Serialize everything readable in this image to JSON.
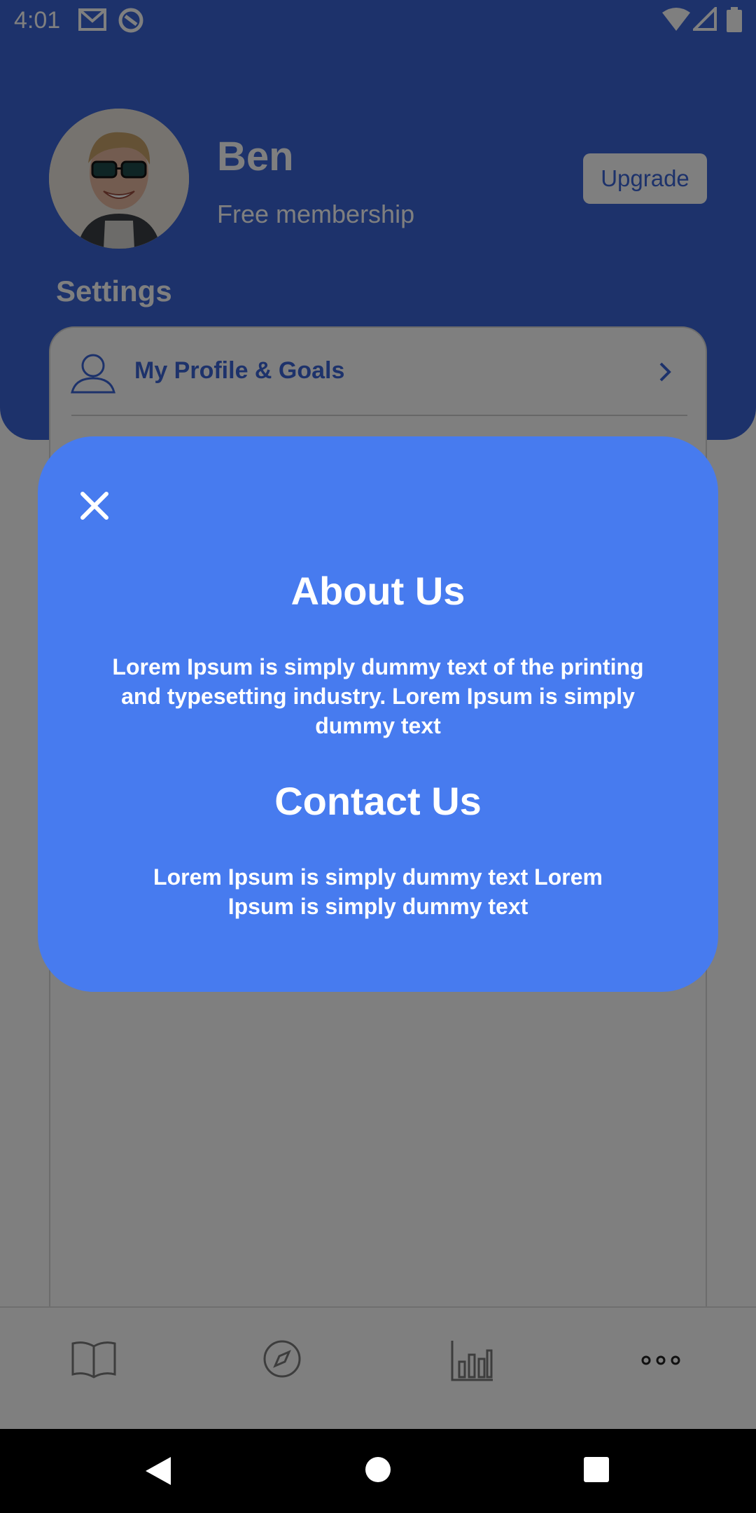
{
  "status_bar": {
    "time": "4:01"
  },
  "profile": {
    "name": "Ben",
    "membership": "Free membership",
    "upgrade_label": "Upgrade"
  },
  "settings": {
    "title": "Settings",
    "items": [
      {
        "label": "My Profile & Goals",
        "icon": "user-icon"
      }
    ]
  },
  "bottom_nav": {
    "items": [
      {
        "icon": "book-icon"
      },
      {
        "icon": "compass-icon"
      },
      {
        "icon": "stats-icon"
      },
      {
        "icon": "more-icon"
      }
    ]
  },
  "modal": {
    "about_title": "About Us",
    "about_text": "Lorem Ipsum is simply dummy text of the printing and typesetting industry. Lorem Ipsum is simply dummy text",
    "contact_title": "Contact Us",
    "contact_text": "Lorem Ipsum is simply dummy text Lorem Ipsum is simply dummy text"
  },
  "colors": {
    "primary": "#3B64D7",
    "modal": "#477BEF"
  }
}
